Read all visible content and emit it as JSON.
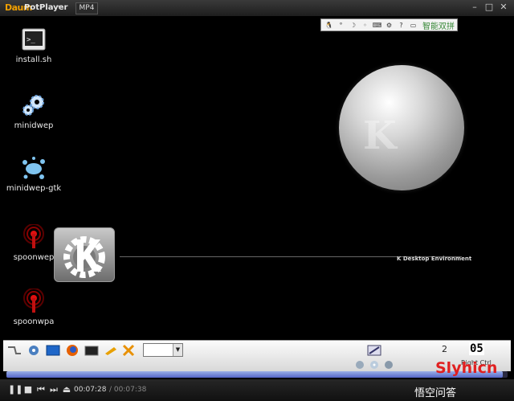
{
  "window": {
    "brand": "Daum",
    "app_name": "PotPlayer",
    "format_tab": "MP4",
    "minimize": "–",
    "maximize": "□",
    "close": "✕"
  },
  "tray": {
    "ime_label": "智能双拼"
  },
  "desktop": {
    "icons": [
      {
        "label": "install.sh",
        "icon": "terminal-icon"
      },
      {
        "label": "minidwep",
        "icon": "gears-icon"
      },
      {
        "label": "minidwep-gtk",
        "icon": "splash-icon"
      },
      {
        "label": "spoonwep",
        "icon": "antenna-icon"
      },
      {
        "label": "spoonwpa",
        "icon": "antenna-icon"
      }
    ],
    "splash_label": "K Desktop Environment"
  },
  "taskbar": {
    "page_number": "2",
    "clock": "05",
    "right_text": "Right Ctrl"
  },
  "player": {
    "progress": 0.99,
    "current_time": "00:07:28",
    "separator": "/",
    "total_time": "00:07:38"
  },
  "watermark": {
    "brand_text": "Slyhicn",
    "qa_text": "悟空问答"
  }
}
